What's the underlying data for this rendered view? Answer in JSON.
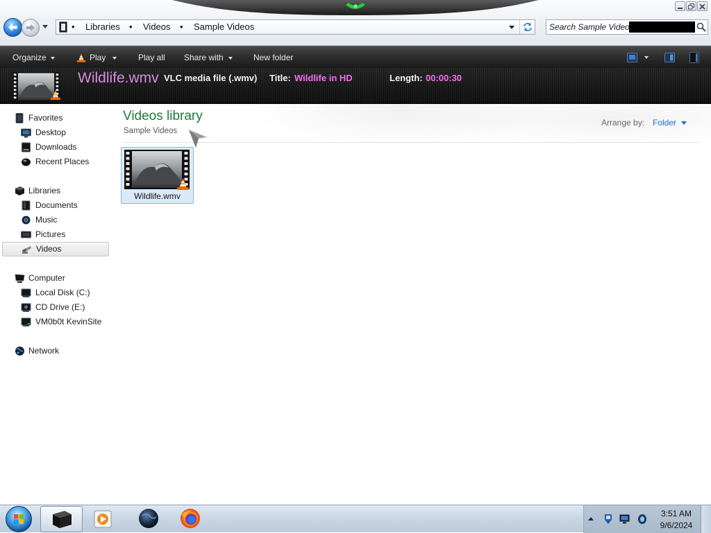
{
  "window": {
    "controls": [
      "minimize-icon",
      "restore-icon",
      "close-icon"
    ]
  },
  "address_bar": {
    "root_icon": "libraries-folder-icon",
    "separator": "•",
    "breadcrumb": [
      "Libraries",
      "Videos",
      "Sample Videos"
    ]
  },
  "search": {
    "placeholder": "Search Sample Videos"
  },
  "toolbar": {
    "organize": "Organize",
    "play": "Play",
    "play_all": "Play all",
    "share_with": "Share with",
    "new_folder": "New folder",
    "right_icons": [
      "change-view-icon",
      "preview-pane-icon",
      "help-icon"
    ]
  },
  "details": {
    "file_name": "Wildlife.wmv",
    "file_type": "VLC media file (.wmv)",
    "title_label": "Title:",
    "title_value": "Wildlife in HD",
    "length_label": "Length:",
    "length_value": "00:00:30"
  },
  "nav": {
    "groups": [
      {
        "label": "Favorites",
        "icon": "favorites-icon",
        "items": [
          {
            "label": "Desktop",
            "icon": "desktop-icon"
          },
          {
            "label": "Downloads",
            "icon": "downloads-icon"
          },
          {
            "label": "Recent Places",
            "icon": "recent-places-icon"
          }
        ]
      },
      {
        "label": "Libraries",
        "icon": "libraries-icon",
        "items": [
          {
            "label": "Documents",
            "icon": "documents-icon"
          },
          {
            "label": "Music",
            "icon": "music-icon"
          },
          {
            "label": "Pictures",
            "icon": "pictures-icon"
          },
          {
            "label": "Videos",
            "icon": "videos-icon",
            "selected": true
          }
        ]
      },
      {
        "label": "Computer",
        "icon": "computer-icon",
        "items": [
          {
            "label": "Local Disk (C:)",
            "icon": "local-disk-icon"
          },
          {
            "label": "CD Drive (E:)",
            "icon": "cd-drive-icon"
          },
          {
            "label": "VM0b0t KevinSite",
            "icon": "network-drive-icon"
          }
        ]
      },
      {
        "label": "Network",
        "icon": "network-icon",
        "items": []
      }
    ]
  },
  "main": {
    "heading": "Videos library",
    "subheading": "Sample Videos",
    "arrange_label": "Arrange by:",
    "arrange_value": "Folder",
    "files": [
      {
        "name": "Wildlife.wmv",
        "icon": "video-thumbnail-icon",
        "selected": true
      }
    ]
  },
  "taskbar": {
    "pinned": [
      "start-orb-icon",
      "explorer-icon",
      "media-player-icon",
      "globe-icon",
      "firefox-icon"
    ],
    "active_app": "explorer-icon",
    "tray_icons": [
      "show-hidden-icons-icon",
      "action-center-icon",
      "network-status-icon",
      "volume-icon"
    ],
    "clock": {
      "time": "3:51 AM",
      "date": "9/6/2024"
    }
  },
  "colors": {
    "file_name_pink": "#d98be4",
    "detail_value_pink": "#f36ff0",
    "heading_green": "#20793a",
    "link_blue": "#1c6ac4",
    "toolbar_text": "#eaeaea",
    "selection_fill": "#dce9f8",
    "selection_border": "#8ab3e2"
  }
}
